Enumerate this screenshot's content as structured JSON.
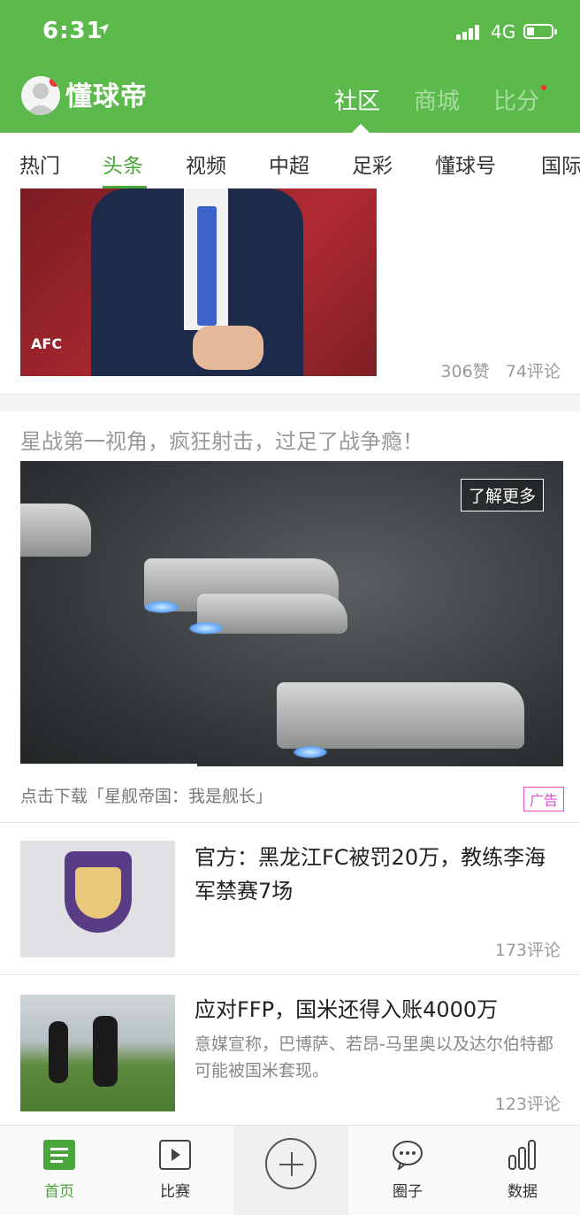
{
  "status_bar": {
    "time": "6:31",
    "network": "4G"
  },
  "app": {
    "name": "懂球帝"
  },
  "top_nav": [
    {
      "label": "社区",
      "active": true
    },
    {
      "label": "商城",
      "active": false
    },
    {
      "label": "比分",
      "active": false
    }
  ],
  "tabs": [
    "热门",
    "头条",
    "视频",
    "中超",
    "足彩",
    "懂球号",
    "国际"
  ],
  "active_tab": "头条",
  "feed": {
    "item1": {
      "image_text": "AFC",
      "likes": "306赞",
      "comments": "74评论"
    },
    "ad": {
      "title": "星战第一视角，疯狂射击，过足了战争瘾！",
      "button": "了解更多",
      "description": "点击下载「星舰帝国：我是舰长」",
      "tag": "广告"
    },
    "news1": {
      "title": "官方：黑龙江FC被罚20万，教练李海军禁赛7场",
      "comments": "173评论"
    },
    "news2": {
      "title": "应对FFP，国米还得入账4000万",
      "summary": "意媒宣称，巴博萨、若昂-马里奥以及达尔伯特都可能被国米套现。",
      "comments": "123评论"
    }
  },
  "bottom_nav": [
    {
      "label": "首页",
      "icon": "home-doc-icon",
      "active": true
    },
    {
      "label": "比赛",
      "icon": "play-icon",
      "active": false
    },
    {
      "label": "",
      "icon": "plus-icon",
      "active": false
    },
    {
      "label": "圈子",
      "icon": "chat-icon",
      "active": false
    },
    {
      "label": "数据",
      "icon": "bar-chart-icon",
      "active": false
    }
  ],
  "colors": {
    "brand_green": "#5cb94c",
    "active_green": "#4aa53a",
    "ad_tag": "#e94bd0"
  }
}
